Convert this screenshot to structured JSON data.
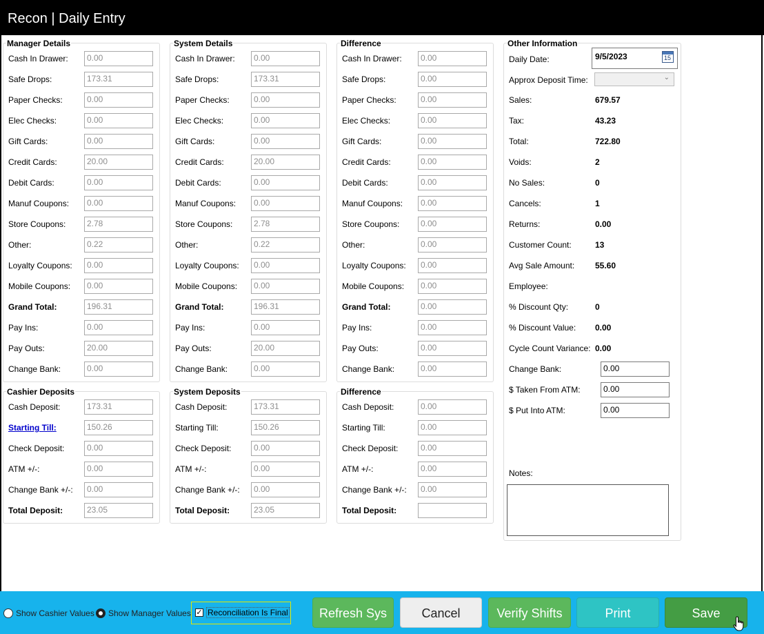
{
  "title": "Recon | Daily Entry",
  "manager_details": {
    "title": "Manager Details",
    "rows": [
      {
        "label": "Cash In Drawer:",
        "value": "0.00"
      },
      {
        "label": "Safe Drops:",
        "value": "173.31"
      },
      {
        "label": "Paper Checks:",
        "value": "0.00"
      },
      {
        "label": "Elec Checks:",
        "value": "0.00"
      },
      {
        "label": "Gift Cards:",
        "value": "0.00"
      },
      {
        "label": "Credit Cards:",
        "value": "20.00"
      },
      {
        "label": "Debit Cards:",
        "value": "0.00"
      },
      {
        "label": "Manuf Coupons:",
        "value": "0.00"
      },
      {
        "label": "Store Coupons:",
        "value": "2.78"
      },
      {
        "label": "Other:",
        "value": "0.22"
      },
      {
        "label": "Loyalty Coupons:",
        "value": "0.00"
      },
      {
        "label": "Mobile Coupons:",
        "value": "0.00"
      },
      {
        "label": "Grand Total:",
        "value": "196.31"
      },
      {
        "label": "Pay Ins:",
        "value": "0.00"
      },
      {
        "label": "Pay Outs:",
        "value": "20.00"
      },
      {
        "label": "Change Bank:",
        "value": "0.00"
      }
    ]
  },
  "system_details": {
    "title": "System Details",
    "rows": [
      {
        "label": "Cash In Drawer:",
        "value": "0.00"
      },
      {
        "label": "Safe Drops:",
        "value": "173.31"
      },
      {
        "label": "Paper Checks:",
        "value": "0.00"
      },
      {
        "label": "Elec Checks:",
        "value": "0.00"
      },
      {
        "label": "Gift Cards:",
        "value": "0.00"
      },
      {
        "label": "Credit Cards:",
        "value": "20.00"
      },
      {
        "label": "Debit Cards:",
        "value": "0.00"
      },
      {
        "label": "Manuf Coupons:",
        "value": "0.00"
      },
      {
        "label": "Store Coupons:",
        "value": "2.78"
      },
      {
        "label": "Other:",
        "value": "0.22"
      },
      {
        "label": "Loyalty Coupons:",
        "value": "0.00"
      },
      {
        "label": "Mobile Coupons:",
        "value": "0.00"
      },
      {
        "label": "Grand Total:",
        "value": "196.31"
      },
      {
        "label": "Pay Ins:",
        "value": "0.00"
      },
      {
        "label": "Pay Outs:",
        "value": "20.00"
      },
      {
        "label": "Change Bank:",
        "value": "0.00"
      }
    ]
  },
  "difference_details": {
    "title": "Difference",
    "rows": [
      {
        "label": "Cash In Drawer:",
        "value": "0.00"
      },
      {
        "label": "Safe Drops:",
        "value": "0.00"
      },
      {
        "label": "Paper Checks:",
        "value": "0.00"
      },
      {
        "label": "Elec Checks:",
        "value": "0.00"
      },
      {
        "label": "Gift Cards:",
        "value": "0.00"
      },
      {
        "label": "Credit Cards:",
        "value": "0.00"
      },
      {
        "label": "Debit Cards:",
        "value": "0.00"
      },
      {
        "label": "Manuf Coupons:",
        "value": "0.00"
      },
      {
        "label": "Store Coupons:",
        "value": "0.00"
      },
      {
        "label": "Other:",
        "value": "0.00"
      },
      {
        "label": "Loyalty Coupons:",
        "value": "0.00"
      },
      {
        "label": "Mobile Coupons:",
        "value": "0.00"
      },
      {
        "label": "Grand Total:",
        "value": "0.00"
      },
      {
        "label": "Pay Ins:",
        "value": "0.00"
      },
      {
        "label": "Pay Outs:",
        "value": "0.00"
      },
      {
        "label": "Change Bank:",
        "value": "0.00"
      }
    ]
  },
  "cashier_deposits": {
    "title": "Cashier Deposits",
    "rows": [
      {
        "label": "Cash Deposit:",
        "value": "173.31"
      },
      {
        "label": "Starting Till:",
        "value": "150.26"
      },
      {
        "label": "Check Deposit:",
        "value": "0.00"
      },
      {
        "label": "ATM +/-:",
        "value": "0.00"
      },
      {
        "label": "Change Bank +/-:",
        "value": "0.00"
      },
      {
        "label": "Total Deposit:",
        "value": "23.05"
      }
    ]
  },
  "system_deposits": {
    "title": "System Deposits",
    "rows": [
      {
        "label": "Cash Deposit:",
        "value": "173.31"
      },
      {
        "label": "Starting Till:",
        "value": "150.26"
      },
      {
        "label": "Check Deposit:",
        "value": "0.00"
      },
      {
        "label": "ATM +/-:",
        "value": "0.00"
      },
      {
        "label": "Change Bank +/-:",
        "value": "0.00"
      },
      {
        "label": "Total Deposit:",
        "value": "23.05"
      }
    ]
  },
  "difference_deposits": {
    "title": "Difference",
    "rows": [
      {
        "label": "Cash Deposit:",
        "value": "0.00"
      },
      {
        "label": "Starting Till:",
        "value": "0.00"
      },
      {
        "label": "Check Deposit:",
        "value": "0.00"
      },
      {
        "label": "ATM +/-:",
        "value": "0.00"
      },
      {
        "label": "Change Bank +/-:",
        "value": "0.00"
      },
      {
        "label": "Total Deposit:",
        "value": ""
      }
    ]
  },
  "other_info": {
    "title": "Other Information",
    "daily_date_label": "Daily Date:",
    "daily_date": "9/5/2023",
    "calendar_day": "15",
    "deposit_time_label": "Approx Deposit Time:",
    "stats": [
      {
        "label": "Sales:",
        "value": "679.57"
      },
      {
        "label": "Tax:",
        "value": "43.23"
      },
      {
        "label": "Total:",
        "value": "722.80"
      },
      {
        "label": "Voids:",
        "value": "2"
      },
      {
        "label": "No Sales:",
        "value": "0"
      },
      {
        "label": "Cancels:",
        "value": "1"
      },
      {
        "label": "Returns:",
        "value": "0.00"
      },
      {
        "label": "Customer Count:",
        "value": "13"
      },
      {
        "label": "Avg Sale Amount:",
        "value": "55.60"
      },
      {
        "label": "Employee:",
        "value": ""
      },
      {
        "label": "% Discount Qty:",
        "value": "0"
      },
      {
        "label": "% Discount Value:",
        "value": "0.00"
      },
      {
        "label": "Cycle Count Variance:",
        "value": "0.00"
      }
    ],
    "inputs": [
      {
        "label": "Change Bank:",
        "value": "0.00"
      },
      {
        "label": "$ Taken From ATM:",
        "value": "0.00"
      },
      {
        "label": "$ Put Into ATM:",
        "value": "0.00"
      }
    ],
    "notes_label": "Notes:"
  },
  "footer": {
    "radio_cashier": "Show Cashier Values",
    "radio_manager": "Show Manager Values",
    "checkbox_final": "Reconciliation Is Final",
    "buttons": {
      "refresh": "Refresh Sys",
      "cancel": "Cancel",
      "verify": "Verify Shifts",
      "print": "Print",
      "save": "Save"
    }
  },
  "colors": {
    "title_bar": "#000000",
    "footer_bar": "#17b3ec",
    "green_button": "#5cb85c",
    "teal_button": "#2ec4c4",
    "dark_green_button": "#449d44",
    "link": "#0000cc"
  }
}
